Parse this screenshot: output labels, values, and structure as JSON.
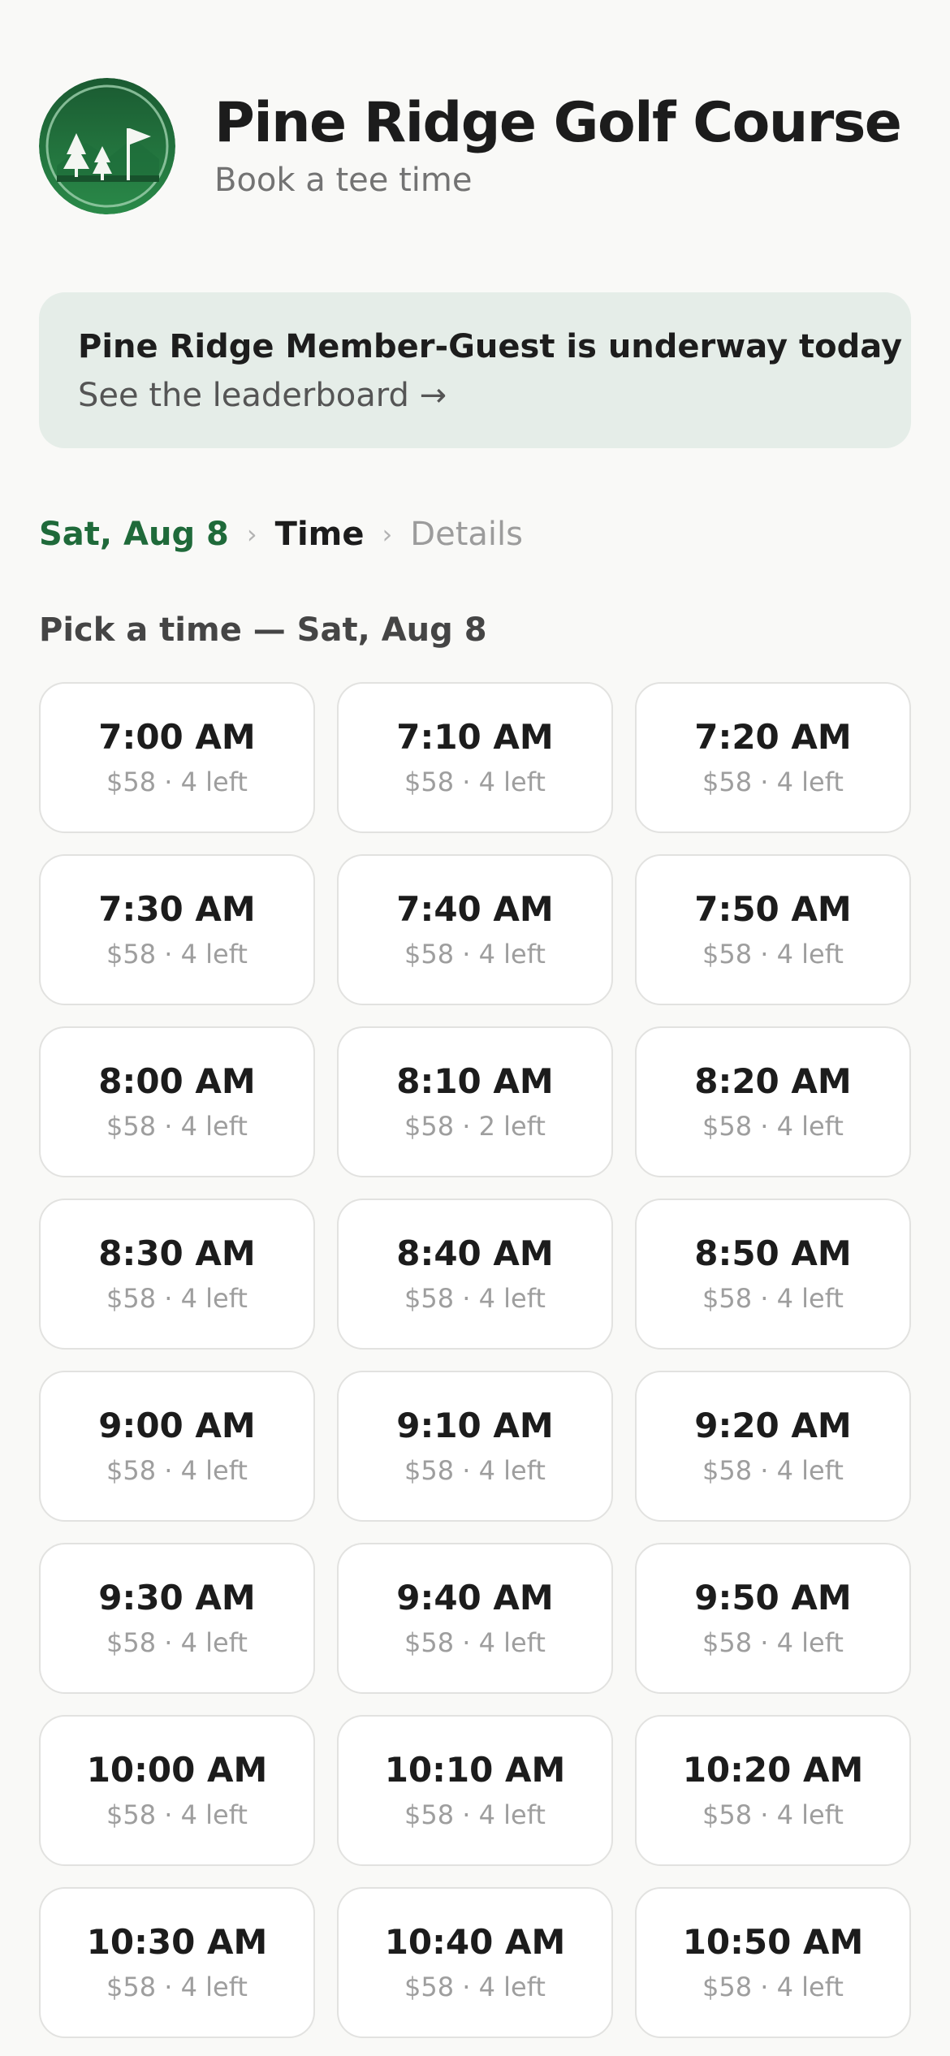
{
  "header": {
    "logo_icon": "golf-course-logo-icon",
    "title": "Pine Ridge Golf Course",
    "subtitle": "Book a tee time"
  },
  "banner": {
    "title": "Pine Ridge Member-Guest is underway today",
    "link": "See the leaderboard →"
  },
  "breadcrumb": {
    "step1": "Sat, Aug 8",
    "step2": "Time",
    "step3": "Details",
    "separator": "›"
  },
  "section_title": "Pick a time — Sat, Aug 8",
  "slots": [
    {
      "time": "7:00 AM",
      "info": "$58 · 4 left"
    },
    {
      "time": "7:10 AM",
      "info": "$58 · 4 left"
    },
    {
      "time": "7:20 AM",
      "info": "$58 · 4 left"
    },
    {
      "time": "7:30 AM",
      "info": "$58 · 4 left"
    },
    {
      "time": "7:40 AM",
      "info": "$58 · 4 left"
    },
    {
      "time": "7:50 AM",
      "info": "$58 · 4 left"
    },
    {
      "time": "8:00 AM",
      "info": "$58 · 4 left"
    },
    {
      "time": "8:10 AM",
      "info": "$58 · 2 left"
    },
    {
      "time": "8:20 AM",
      "info": "$58 · 4 left"
    },
    {
      "time": "8:30 AM",
      "info": "$58 · 4 left"
    },
    {
      "time": "8:40 AM",
      "info": "$58 · 4 left"
    },
    {
      "time": "8:50 AM",
      "info": "$58 · 4 left"
    },
    {
      "time": "9:00 AM",
      "info": "$58 · 4 left"
    },
    {
      "time": "9:10 AM",
      "info": "$58 · 4 left"
    },
    {
      "time": "9:20 AM",
      "info": "$58 · 4 left"
    },
    {
      "time": "9:30 AM",
      "info": "$58 · 4 left"
    },
    {
      "time": "9:40 AM",
      "info": "$58 · 4 left"
    },
    {
      "time": "9:50 AM",
      "info": "$58 · 4 left"
    },
    {
      "time": "10:00 AM",
      "info": "$58 · 4 left"
    },
    {
      "time": "10:10 AM",
      "info": "$58 · 4 left"
    },
    {
      "time": "10:20 AM",
      "info": "$58 · 4 left"
    },
    {
      "time": "10:30 AM",
      "info": "$58 · 4 left"
    },
    {
      "time": "10:40 AM",
      "info": "$58 · 4 left"
    },
    {
      "time": "10:50 AM",
      "info": "$58 · 4 left"
    }
  ],
  "colors": {
    "background": "#f9f9f7",
    "brand_green": "#1f6a3a",
    "banner_bg": "#e5ede8",
    "slot_border": "#e2e2e0"
  }
}
